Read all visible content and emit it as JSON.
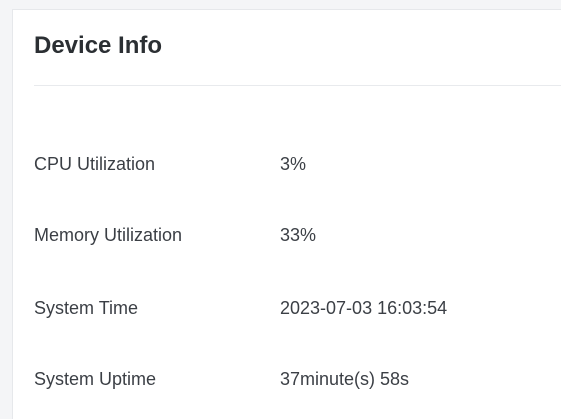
{
  "panel": {
    "title": "Device Info"
  },
  "rows": [
    {
      "label": "CPU Utilization",
      "value": "3%"
    },
    {
      "label": "Memory Utilization",
      "value": "33%"
    },
    {
      "label": "System Time",
      "value": "2023-07-03 16:03:54"
    },
    {
      "label": "System Uptime",
      "value": "37minute(s) 58s"
    }
  ]
}
